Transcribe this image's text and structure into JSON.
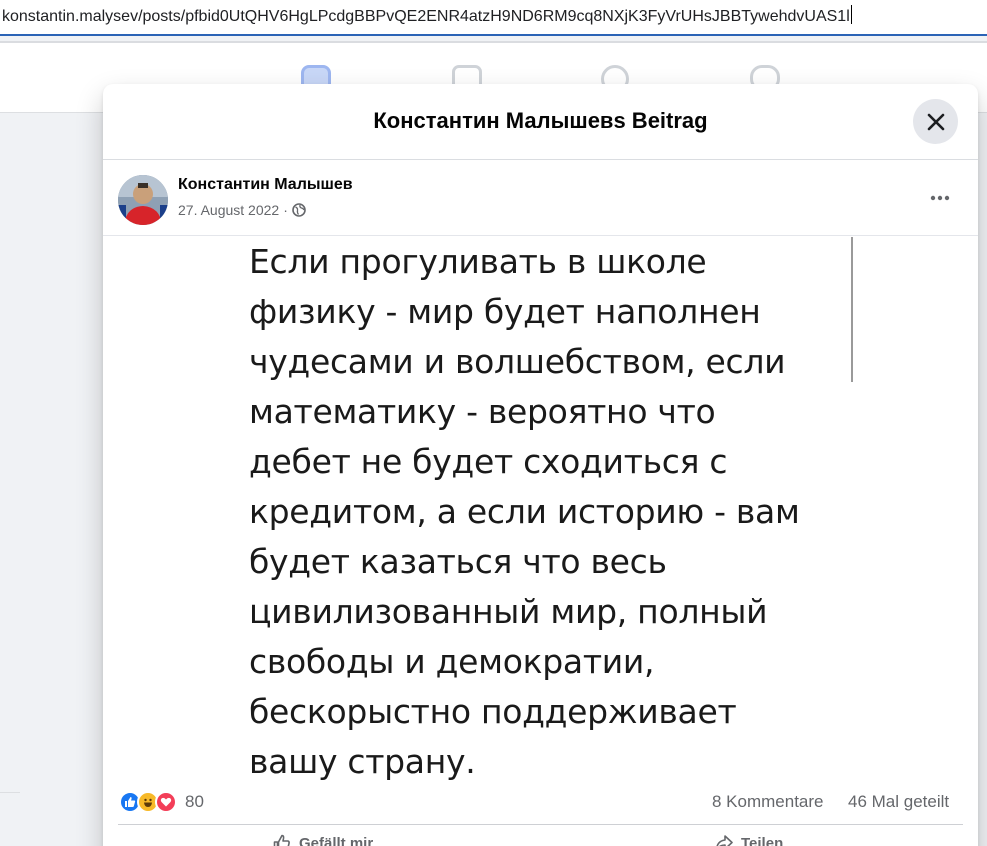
{
  "browser": {
    "url": "konstantin.malysev/posts/pfbid0UtQHV6HgLPcdgBBPvQE2ENR4atzH9ND6RM9cq8NXjK3FyVrUHsJBBTywehdvUAS1l"
  },
  "modal": {
    "title": "Константин Малышевs Beitrag",
    "close_icon": "close-icon"
  },
  "post": {
    "author": "Константин Малышев",
    "date": "27. August 2022",
    "separator": "·",
    "audience_icon": "globe-icon",
    "more_icon": "more-options-icon",
    "image_text_lines": [
      "Если прогуливать в школе",
      "физику - мир будет наполнен",
      "чудесами и волшебством, если",
      "математику - вероятно что",
      "дебет не будет сходиться с",
      "кредитом, а если историю - вам",
      "будет казаться что весь",
      "цивилизованный мир, полный",
      "свободы и демократии,",
      "бескорыстно поддерживает",
      "вашу страну."
    ]
  },
  "stats": {
    "reactions": [
      "like-icon",
      "haha-icon",
      "love-icon"
    ],
    "reaction_count": "80",
    "comments": "8 Kommentare",
    "shares": "46 Mal geteilt"
  },
  "actions": {
    "like_label": "Gefällt mir",
    "share_label": "Teilen"
  },
  "colors": {
    "accent": "#1877f2",
    "address_underline": "#2b63b6",
    "secondary_text": "#65676b",
    "close_button_bg": "#e4e6eb"
  }
}
